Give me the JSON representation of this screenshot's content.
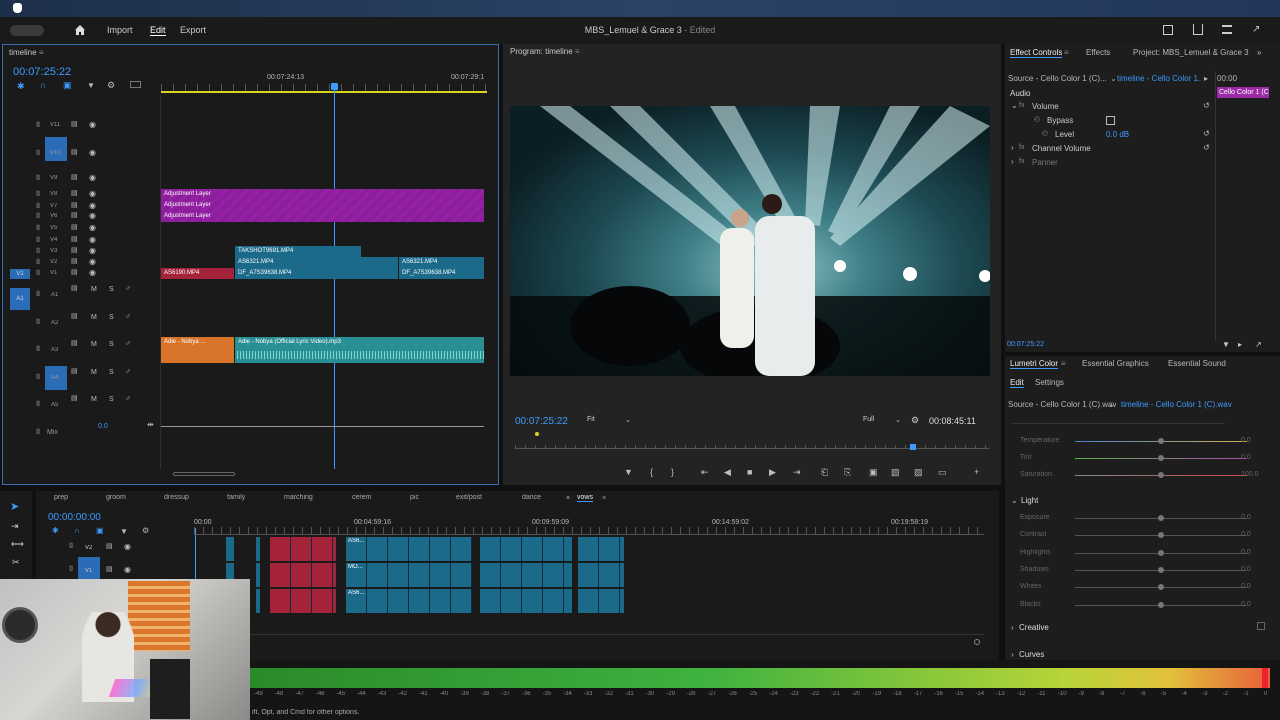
{
  "app": {
    "title": "MBS_Lemuel & Grace 3",
    "edited": " - Edited",
    "nav": [
      "Import",
      "Edit",
      "Export"
    ],
    "active_nav": "Edit"
  },
  "timeline_panel": {
    "tab": "timeline",
    "timecode": "00:07:25:22",
    "ruler": [
      "00:07:24:13",
      "00:07:29:1"
    ],
    "video_tracks": [
      "V11",
      "V10",
      "V9",
      "V8",
      "V7",
      "V6",
      "V5",
      "V4",
      "V3",
      "V2",
      "V1"
    ],
    "audio_tracks": [
      "A1",
      "A2",
      "A3",
      "A4",
      "A5"
    ],
    "mix_label": "Mix",
    "mix_value": "0.0",
    "source_v": "V1",
    "source_a": "A1",
    "clips": {
      "adj1": "Adjustment Layer",
      "adj2": "Adjustment Layer",
      "adj3": "Adjustment Layer",
      "v3a": "TAKSHOT9691.MP4",
      "v2a": "AS6321.MP4",
      "v2b": "AS6321.MP4",
      "v1a": "AS6190.MP4",
      "v1b": "DF_A7S39638.MP4",
      "v1c": "DF_A7S39638.MP4",
      "a3a": "Adie - Nobya ...",
      "a3b": "Adie - Nobya (Official Lyric Video).mp3"
    },
    "fx": "fx"
  },
  "program": {
    "title": "Program: timeline",
    "timecode": "00:07:25:22",
    "fit": "Fit",
    "quality": "Full",
    "duration": "00:08:45:11"
  },
  "effect_controls": {
    "tabs": [
      "Effect Controls",
      "Effects",
      "Project: MBS_Lemuel & Grace 3"
    ],
    "source": "Source - Cello Color 1 (C)...",
    "target": "timeline - Cello Color 1...",
    "time_start": "00:00",
    "clip": "Cello Color 1 (C",
    "section": "Audio",
    "items": [
      {
        "label": "Volume"
      },
      {
        "label": "Bypass"
      },
      {
        "label": "Level",
        "value": "0.0 dB"
      },
      {
        "label": "Channel Volume"
      },
      {
        "label": "Panner"
      }
    ],
    "timecode": "00:07:25:22"
  },
  "lumetri": {
    "tabs": [
      "Lumetri Color",
      "Essential Graphics",
      "Essential Sound"
    ],
    "subtabs": [
      "Edit",
      "Settings"
    ],
    "source": "Source - Cello Color 1 (C).wav",
    "target": "timeline - Cello Color 1 (C).wav",
    "rows": [
      {
        "label": "Temperature",
        "value": "0.0"
      },
      {
        "label": "Tint",
        "value": "0.0"
      },
      {
        "label": "Saturation",
        "value": "100.0"
      }
    ],
    "light_title": "Light",
    "light_rows": [
      {
        "label": "Exposure",
        "value": "0.0"
      },
      {
        "label": "Contrast",
        "value": "0.0"
      },
      {
        "label": "Highlights",
        "value": "0.0"
      },
      {
        "label": "Shadows",
        "value": "0.0"
      },
      {
        "label": "Whites",
        "value": "0.0"
      },
      {
        "label": "Blacks",
        "value": "0.0"
      }
    ],
    "creative": "Creative",
    "curves": "Curves"
  },
  "seq": {
    "tabs": [
      "prep",
      "groom",
      "dressup",
      "family",
      "marching",
      "cerem",
      "pic",
      "exit/post",
      "dance",
      "vows"
    ],
    "active": "vows",
    "timecode": "00:00:00:00",
    "ruler": [
      "00:00",
      "00:04:59:16",
      "00:09:59:09",
      "00:14:59:02",
      "00:19:58:19"
    ],
    "tracks": [
      "V2",
      "V1"
    ],
    "clip_labels": [
      "AS6...",
      "MO...",
      "AS6..."
    ]
  },
  "meter": {
    "ticks": [
      "-49",
      "-48",
      "-47",
      "-46",
      "-45",
      "-44",
      "-43",
      "-42",
      "-41",
      "-40",
      "-39",
      "-38",
      "-37",
      "-36",
      "-35",
      "-34",
      "-33",
      "-32",
      "-31",
      "-30",
      "-29",
      "-28",
      "-27",
      "-26",
      "-25",
      "-24",
      "-23",
      "-22",
      "-21",
      "-20",
      "-19",
      "-18",
      "-17",
      "-16",
      "-15",
      "-14",
      "-13",
      "-12",
      "-11",
      "-10",
      "-9",
      "-8",
      "-7",
      "-6",
      "-5",
      "-4",
      "-3",
      "-2",
      "-1",
      "0"
    ]
  },
  "status": "ift, Opt, and Cmd for other options."
}
